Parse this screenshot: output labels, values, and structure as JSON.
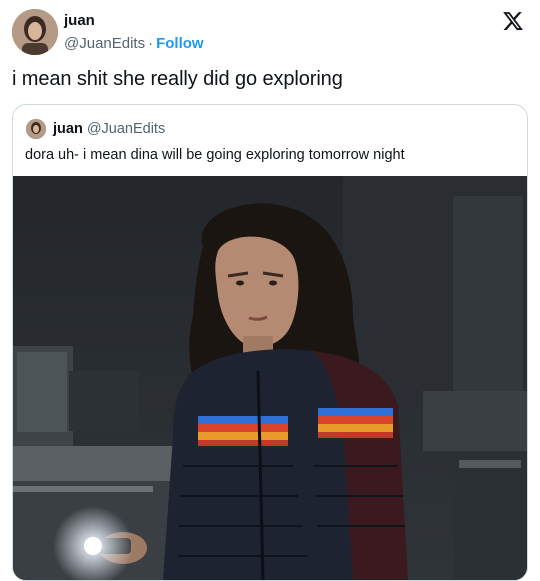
{
  "author": {
    "name": "juan",
    "handle": "@JuanEdits",
    "separator": "·",
    "follow_label": "Follow",
    "avatar_icon": "profile-photo"
  },
  "platform_icon": "x-logo-icon",
  "tweet": {
    "text": "i mean shit she really did go exploring"
  },
  "quoted_tweet": {
    "name": "juan",
    "handle": "@JuanEdits",
    "text": "dora uh- i mean dina will be going exploring tomorrow night",
    "media": "photo of a dark-haired woman in a striped puffer jacket holding a flashlight in a dim room"
  },
  "colors": {
    "follow": "#1d9bf0",
    "handle": "#536471",
    "text": "#0f1419",
    "border": "#cfd9de"
  }
}
